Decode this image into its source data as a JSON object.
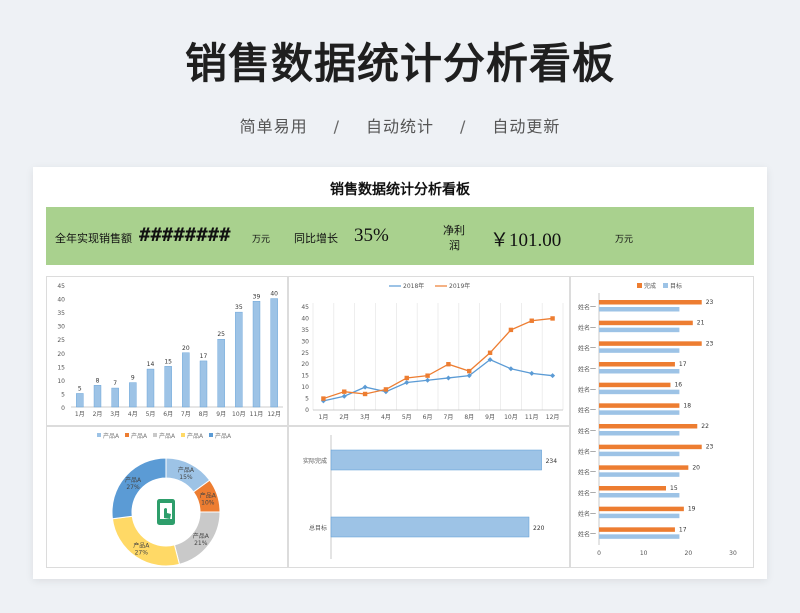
{
  "header": {
    "title": "销售数据统计分析看板",
    "subtitle_items": [
      "简单易用",
      "自动统计",
      "自动更新"
    ],
    "separator": "/"
  },
  "sheet": {
    "title": "销售数据统计分析看板",
    "kpi": {
      "sales_label": "全年实现销售额",
      "sales_value": "########",
      "sales_unit": "万元",
      "growth_label": "同比增长",
      "growth_value": "35%",
      "profit_label_line1": "净利",
      "profit_label_line2": "润",
      "profit_value": "￥101.00",
      "profit_unit": "万元"
    },
    "colors": {
      "kpi_bg": "#a9d18e",
      "blue": "#9dc3e6",
      "blue_dark": "#5b9bd5",
      "orange": "#ed7d31",
      "gray": "#c9c9c9",
      "yellow": "#ffd966"
    }
  },
  "chart_data": [
    {
      "type": "bar",
      "categories": [
        "1月",
        "2月",
        "3月",
        "4月",
        "5月",
        "6月",
        "7月",
        "8月",
        "9月",
        "10月",
        "11月",
        "12月"
      ],
      "values": [
        5,
        8,
        7,
        9,
        14,
        15,
        20,
        17,
        25,
        35,
        39,
        40
      ],
      "ylim": [
        0,
        45
      ],
      "yticks": [
        0,
        5,
        10,
        15,
        20,
        25,
        30,
        35,
        40,
        45
      ],
      "grid": false
    },
    {
      "type": "line",
      "categories": [
        "1月",
        "2月",
        "3月",
        "4月",
        "5月",
        "6月",
        "7月",
        "8月",
        "9月",
        "10月",
        "11月",
        "12月"
      ],
      "series": [
        {
          "name": "2018年",
          "values": [
            4,
            6,
            10,
            8,
            12,
            13,
            14,
            15,
            22,
            18,
            16,
            15
          ]
        },
        {
          "name": "2019年",
          "values": [
            5,
            8,
            7,
            9,
            14,
            15,
            20,
            17,
            25,
            35,
            39,
            40
          ]
        }
      ],
      "ylim": [
        0,
        45
      ],
      "yticks": [
        0,
        5,
        10,
        15,
        20,
        25,
        30,
        35,
        40,
        45
      ],
      "grid": true,
      "legend": "top"
    },
    {
      "type": "bar",
      "orientation": "horizontal",
      "categories": [
        "姓名一",
        "姓名一",
        "姓名一",
        "姓名一",
        "姓名一",
        "姓名一",
        "姓名一",
        "姓名一",
        "姓名一",
        "姓名一",
        "姓名一",
        "姓名一"
      ],
      "series": [
        {
          "name": "完成",
          "values": [
            23,
            21,
            23,
            17,
            16,
            18,
            22,
            23,
            20,
            15,
            19,
            17
          ]
        },
        {
          "name": "目标",
          "values": [
            18,
            18,
            18,
            18,
            18,
            18,
            18,
            18,
            18,
            18,
            18,
            18
          ]
        }
      ],
      "xlim": [
        0,
        30
      ],
      "xticks": [
        0,
        10,
        20,
        30
      ],
      "legend": "top"
    },
    {
      "type": "pie",
      "donut": true,
      "labels": [
        "产品A",
        "产品A",
        "产品A",
        "产品A",
        "产品A"
      ],
      "values": [
        15,
        10,
        21,
        27,
        27
      ],
      "percent_labels": [
        "15%",
        "10%",
        "21%",
        "27%",
        "27%"
      ],
      "legend": "top",
      "center_icon": "mobile-payment-icon"
    },
    {
      "type": "bar",
      "orientation": "horizontal",
      "categories": [
        "实际完成",
        "总目标"
      ],
      "values": [
        234,
        220
      ],
      "xlim": [
        0,
        240
      ]
    }
  ]
}
